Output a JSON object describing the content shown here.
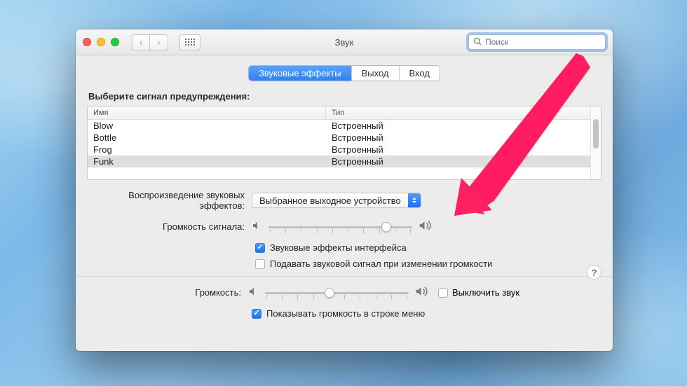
{
  "window": {
    "title": "Звук",
    "search_placeholder": "Поиск"
  },
  "tabs": [
    {
      "label": "Звуковые эффекты",
      "active": true
    },
    {
      "label": "Выход",
      "active": false
    },
    {
      "label": "Вход",
      "active": false
    }
  ],
  "alert_section": {
    "heading": "Выберите сигнал предупреждения:",
    "columns": {
      "name": "Имя",
      "type": "Тип"
    },
    "rows": [
      {
        "name": "Blow",
        "type": "Встроенный",
        "selected": false
      },
      {
        "name": "Bottle",
        "type": "Встроенный",
        "selected": false
      },
      {
        "name": "Frog",
        "type": "Встроенный",
        "selected": false
      },
      {
        "name": "Funk",
        "type": "Встроенный",
        "selected": true
      }
    ]
  },
  "effects_output": {
    "label": "Воспроизведение звуковых эффектов:",
    "value": "Выбранное выходное устройство"
  },
  "alert_volume": {
    "label": "Громкость сигнала:",
    "percent": 82
  },
  "checkboxes": {
    "ui_effects": {
      "label": "Звуковые эффекты интерфейса",
      "checked": true
    },
    "volume_feedback": {
      "label": "Подавать звуковой сигнал при изменении громкости",
      "checked": false
    },
    "menu_bar": {
      "label": "Показывать громкость в строке меню",
      "checked": true
    }
  },
  "output_volume": {
    "label": "Громкость:",
    "percent": 45,
    "mute_label": "Выключить звук",
    "mute_checked": false
  }
}
